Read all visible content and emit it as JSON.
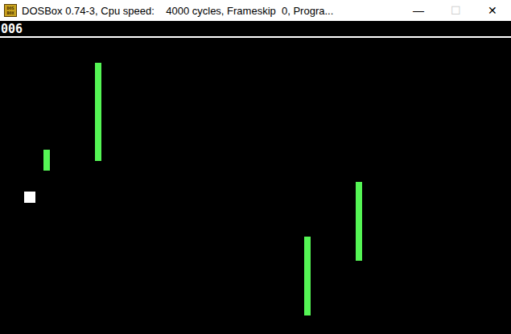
{
  "window": {
    "title": "DOSBox 0.74-3, Cpu speed:    4000 cycles, Frameskip  0, Progra...",
    "logo": [
      "DOS",
      "BOX"
    ],
    "controls": [
      {
        "label": "—",
        "disabled": false
      },
      {
        "label": "☐",
        "disabled": true
      },
      {
        "label": "✕",
        "disabled": false
      }
    ]
  },
  "game": {
    "score": "006",
    "obstacles": [
      {},
      {},
      {},
      {}
    ]
  }
}
